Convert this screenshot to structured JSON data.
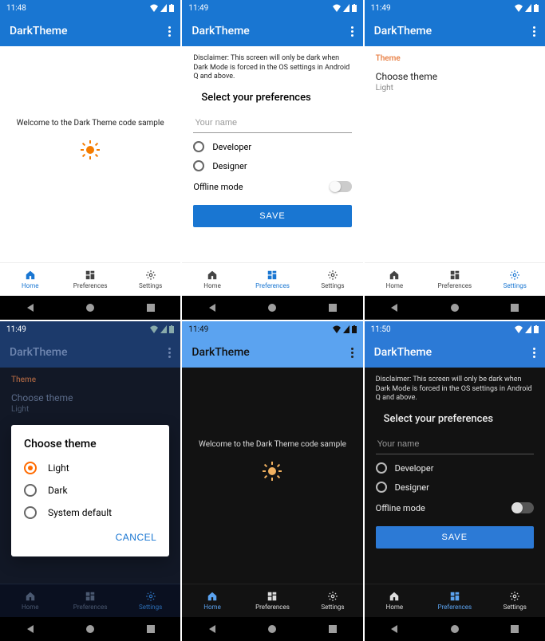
{
  "statusTimes": [
    "11:48",
    "11:49",
    "11:49",
    "11:49",
    "11:49",
    "11:50"
  ],
  "appTitle": "DarkTheme",
  "welcome": "Welcome to the Dark Theme code sample",
  "nav": {
    "home": "Home",
    "prefs": "Preferences",
    "settings": "Settings"
  },
  "prefs": {
    "disclaimer": "Disclaimer: This screen will only be dark when Dark Mode is forced in the OS settings in Android Q and above.",
    "title": "Select your preferences",
    "placeholder": "Your name",
    "developer": "Developer",
    "designer": "Designer",
    "offline": "Offline mode",
    "save": "SAVE"
  },
  "settings": {
    "header": "Theme",
    "choose": "Choose theme",
    "value": "Light"
  },
  "dialog": {
    "title": "Choose theme",
    "opt1": "Light",
    "opt2": "Dark",
    "opt3": "System default",
    "cancel": "CANCEL"
  }
}
